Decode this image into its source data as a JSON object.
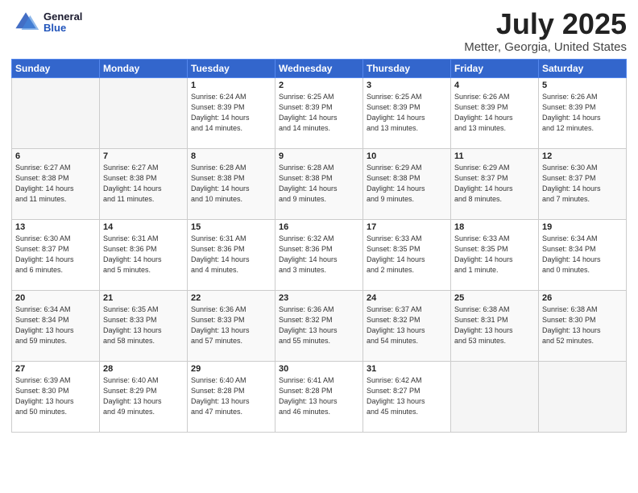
{
  "header": {
    "logo_general": "General",
    "logo_blue": "Blue",
    "main_title": "July 2025",
    "sub_title": "Metter, Georgia, United States"
  },
  "weekdays": [
    "Sunday",
    "Monday",
    "Tuesday",
    "Wednesday",
    "Thursday",
    "Friday",
    "Saturday"
  ],
  "weeks": [
    [
      {
        "day": "",
        "info": ""
      },
      {
        "day": "",
        "info": ""
      },
      {
        "day": "1",
        "info": "Sunrise: 6:24 AM\nSunset: 8:39 PM\nDaylight: 14 hours\nand 14 minutes."
      },
      {
        "day": "2",
        "info": "Sunrise: 6:25 AM\nSunset: 8:39 PM\nDaylight: 14 hours\nand 14 minutes."
      },
      {
        "day": "3",
        "info": "Sunrise: 6:25 AM\nSunset: 8:39 PM\nDaylight: 14 hours\nand 13 minutes."
      },
      {
        "day": "4",
        "info": "Sunrise: 6:26 AM\nSunset: 8:39 PM\nDaylight: 14 hours\nand 13 minutes."
      },
      {
        "day": "5",
        "info": "Sunrise: 6:26 AM\nSunset: 8:39 PM\nDaylight: 14 hours\nand 12 minutes."
      }
    ],
    [
      {
        "day": "6",
        "info": "Sunrise: 6:27 AM\nSunset: 8:38 PM\nDaylight: 14 hours\nand 11 minutes."
      },
      {
        "day": "7",
        "info": "Sunrise: 6:27 AM\nSunset: 8:38 PM\nDaylight: 14 hours\nand 11 minutes."
      },
      {
        "day": "8",
        "info": "Sunrise: 6:28 AM\nSunset: 8:38 PM\nDaylight: 14 hours\nand 10 minutes."
      },
      {
        "day": "9",
        "info": "Sunrise: 6:28 AM\nSunset: 8:38 PM\nDaylight: 14 hours\nand 9 minutes."
      },
      {
        "day": "10",
        "info": "Sunrise: 6:29 AM\nSunset: 8:38 PM\nDaylight: 14 hours\nand 9 minutes."
      },
      {
        "day": "11",
        "info": "Sunrise: 6:29 AM\nSunset: 8:37 PM\nDaylight: 14 hours\nand 8 minutes."
      },
      {
        "day": "12",
        "info": "Sunrise: 6:30 AM\nSunset: 8:37 PM\nDaylight: 14 hours\nand 7 minutes."
      }
    ],
    [
      {
        "day": "13",
        "info": "Sunrise: 6:30 AM\nSunset: 8:37 PM\nDaylight: 14 hours\nand 6 minutes."
      },
      {
        "day": "14",
        "info": "Sunrise: 6:31 AM\nSunset: 8:36 PM\nDaylight: 14 hours\nand 5 minutes."
      },
      {
        "day": "15",
        "info": "Sunrise: 6:31 AM\nSunset: 8:36 PM\nDaylight: 14 hours\nand 4 minutes."
      },
      {
        "day": "16",
        "info": "Sunrise: 6:32 AM\nSunset: 8:36 PM\nDaylight: 14 hours\nand 3 minutes."
      },
      {
        "day": "17",
        "info": "Sunrise: 6:33 AM\nSunset: 8:35 PM\nDaylight: 14 hours\nand 2 minutes."
      },
      {
        "day": "18",
        "info": "Sunrise: 6:33 AM\nSunset: 8:35 PM\nDaylight: 14 hours\nand 1 minute."
      },
      {
        "day": "19",
        "info": "Sunrise: 6:34 AM\nSunset: 8:34 PM\nDaylight: 14 hours\nand 0 minutes."
      }
    ],
    [
      {
        "day": "20",
        "info": "Sunrise: 6:34 AM\nSunset: 8:34 PM\nDaylight: 13 hours\nand 59 minutes."
      },
      {
        "day": "21",
        "info": "Sunrise: 6:35 AM\nSunset: 8:33 PM\nDaylight: 13 hours\nand 58 minutes."
      },
      {
        "day": "22",
        "info": "Sunrise: 6:36 AM\nSunset: 8:33 PM\nDaylight: 13 hours\nand 57 minutes."
      },
      {
        "day": "23",
        "info": "Sunrise: 6:36 AM\nSunset: 8:32 PM\nDaylight: 13 hours\nand 55 minutes."
      },
      {
        "day": "24",
        "info": "Sunrise: 6:37 AM\nSunset: 8:32 PM\nDaylight: 13 hours\nand 54 minutes."
      },
      {
        "day": "25",
        "info": "Sunrise: 6:38 AM\nSunset: 8:31 PM\nDaylight: 13 hours\nand 53 minutes."
      },
      {
        "day": "26",
        "info": "Sunrise: 6:38 AM\nSunset: 8:30 PM\nDaylight: 13 hours\nand 52 minutes."
      }
    ],
    [
      {
        "day": "27",
        "info": "Sunrise: 6:39 AM\nSunset: 8:30 PM\nDaylight: 13 hours\nand 50 minutes."
      },
      {
        "day": "28",
        "info": "Sunrise: 6:40 AM\nSunset: 8:29 PM\nDaylight: 13 hours\nand 49 minutes."
      },
      {
        "day": "29",
        "info": "Sunrise: 6:40 AM\nSunset: 8:28 PM\nDaylight: 13 hours\nand 47 minutes."
      },
      {
        "day": "30",
        "info": "Sunrise: 6:41 AM\nSunset: 8:28 PM\nDaylight: 13 hours\nand 46 minutes."
      },
      {
        "day": "31",
        "info": "Sunrise: 6:42 AM\nSunset: 8:27 PM\nDaylight: 13 hours\nand 45 minutes."
      },
      {
        "day": "",
        "info": ""
      },
      {
        "day": "",
        "info": ""
      }
    ]
  ]
}
